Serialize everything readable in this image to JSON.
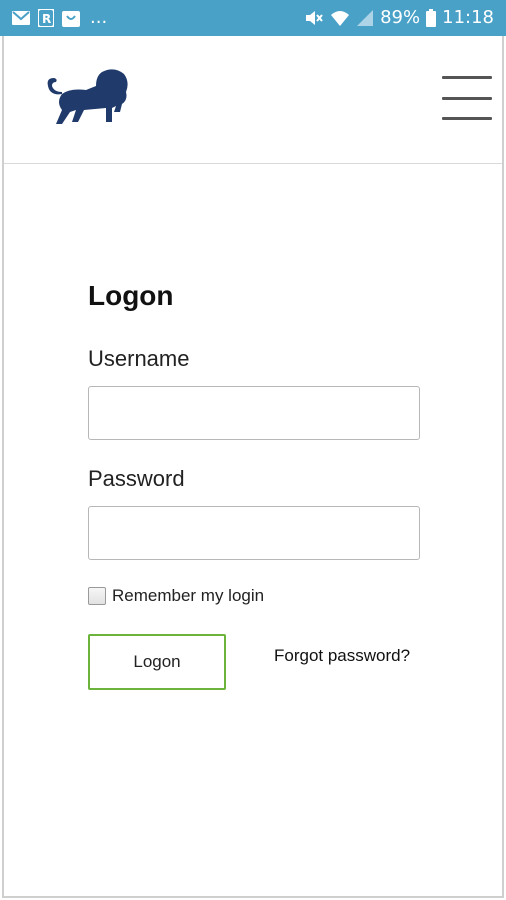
{
  "status_bar": {
    "left_icons": [
      "mail-icon",
      "r-app-icon",
      "shopping-bag-icon"
    ],
    "overflow": "...",
    "right_icons": [
      "mute-icon",
      "wifi-icon",
      "signal-icon",
      "battery-icon"
    ],
    "battery": "89%",
    "time": "11:18"
  },
  "header": {
    "logo_icon": "lion-logo",
    "menu_icon": "hamburger-menu-icon",
    "logo_color": "#1f3a6b"
  },
  "form": {
    "title": "Logon",
    "username_label": "Username",
    "username_value": "",
    "password_label": "Password",
    "password_value": "",
    "remember_label": "Remember my login",
    "remember_checked": false,
    "submit_label": "Logon",
    "forgot_label": "Forgot password?"
  },
  "colors": {
    "status_bar": "#4aa1c7",
    "button_border": "#6bb33a"
  }
}
